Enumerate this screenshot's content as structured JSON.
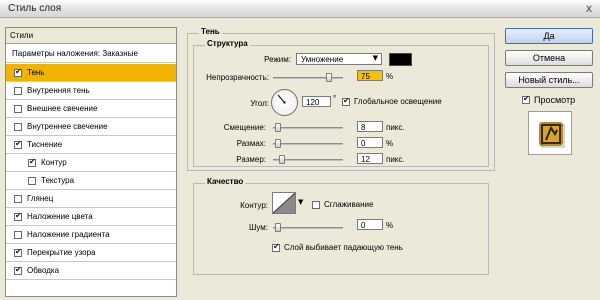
{
  "window": {
    "title": "Стиль слоя",
    "close_glyph": "x"
  },
  "styles_panel": {
    "header": "Стили",
    "blending_options": "Параметры наложения: Заказные",
    "items": [
      {
        "label": "Тень",
        "checked": true,
        "selected": true
      },
      {
        "label": "Внутренняя тень",
        "checked": false
      },
      {
        "label": "Внешнее свечение",
        "checked": false
      },
      {
        "label": "Внутреннее свечение",
        "checked": false
      },
      {
        "label": "Тиснение",
        "checked": true
      },
      {
        "label": "Контур",
        "checked": true,
        "indent": true
      },
      {
        "label": "Текстура",
        "checked": false,
        "indent": true
      },
      {
        "label": "Глянец",
        "checked": false
      },
      {
        "label": "Наложение цвета",
        "checked": true
      },
      {
        "label": "Наложение градиента",
        "checked": false
      },
      {
        "label": "Перекрытие узора",
        "checked": true
      },
      {
        "label": "Обводка",
        "checked": true
      }
    ]
  },
  "shadow": {
    "section_title": "Тень",
    "structure_title": "Структура",
    "mode_label": "Режим:",
    "mode_value": "Умножение",
    "mode_color": "#000000",
    "opacity_label": "Непрозрачность:",
    "opacity_value": "75",
    "opacity_unit": "%",
    "opacity_level": 0.75,
    "angle_label": "Угол:",
    "angle_value": "120",
    "angle_unit": "°",
    "global_light_label": "Глобальное освещение",
    "global_light_checked": true,
    "distance_label": "Смещение:",
    "distance_value": "8",
    "distance_unit": "пикс.",
    "spread_label": "Размах:",
    "spread_value": "0",
    "spread_unit": "%",
    "size_label": "Размер:",
    "size_value": "12",
    "size_unit": "пикс."
  },
  "quality": {
    "title": "Качество",
    "contour_label": "Контур:",
    "antialias_label": "Сглаживание",
    "antialias_checked": false,
    "noise_label": "Шум:",
    "noise_value": "0",
    "noise_unit": "%",
    "knockout_label": "Слой выбивает падающую тень",
    "knockout_checked": true
  },
  "buttons": {
    "ok": "Да",
    "cancel": "Отмена",
    "new_style": "Новый стиль...",
    "preview_label": "Просмотр",
    "preview_checked": true
  },
  "colors": {
    "selection": "#f0b400",
    "field_highlight": "#f6c200",
    "dialog_bg": "#ece9d8"
  }
}
